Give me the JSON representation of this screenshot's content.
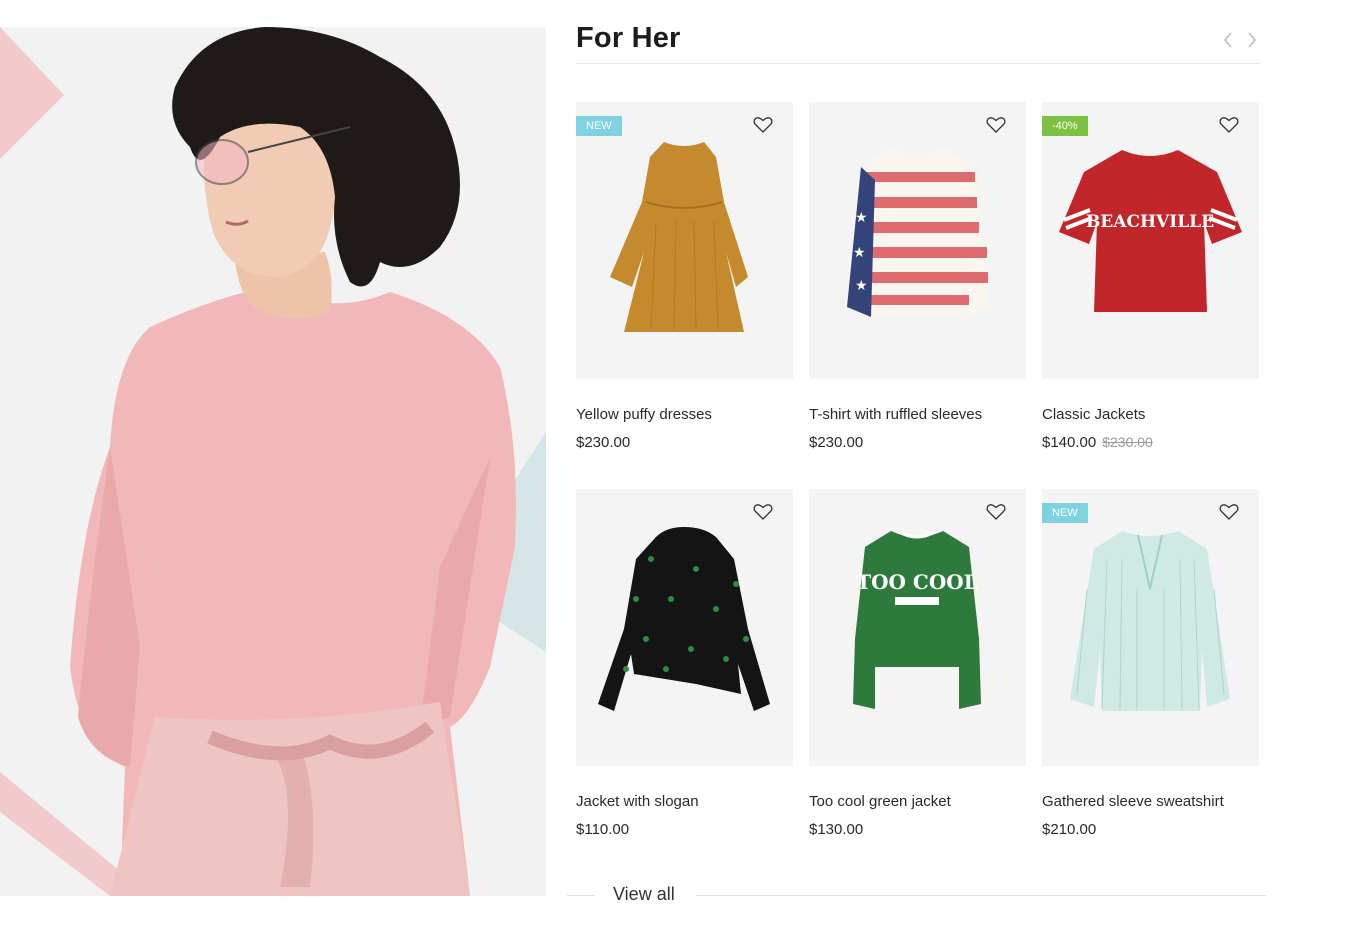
{
  "section": {
    "title": "For Her",
    "prev_icon": "chevron-left-icon",
    "next_icon": "chevron-right-icon"
  },
  "products": [
    {
      "name": "Yellow puffy dresses",
      "price": "$230.00",
      "old_price": "",
      "badge": "NEW",
      "badge_type": "new",
      "color": "#c58a2e"
    },
    {
      "name": "T-shirt with ruffled sleeves",
      "price": "$230.00",
      "old_price": "",
      "badge": "",
      "badge_type": "",
      "color": "#d9595f"
    },
    {
      "name": "Classic Jackets",
      "price": "$140.00",
      "old_price": "$230.00",
      "badge": "-40%",
      "badge_type": "sale",
      "color": "#c1262b"
    },
    {
      "name": "Jacket with slogan",
      "price": "$110.00",
      "old_price": "",
      "badge": "",
      "badge_type": "",
      "color": "#141414"
    },
    {
      "name": "Too cool green jacket",
      "price": "$130.00",
      "old_price": "",
      "badge": "",
      "badge_type": "",
      "color": "#2e7a3c"
    },
    {
      "name": "Gathered sleeve sweatshirt",
      "price": "$210.00",
      "old_price": "",
      "badge": "NEW",
      "badge_type": "new",
      "color": "#bfe1dc"
    }
  ],
  "graphics": {
    "tshirt_print": "BEACHVILLE",
    "sweater_print": "TOO COOL"
  },
  "footer": {
    "view_all": "View all"
  }
}
